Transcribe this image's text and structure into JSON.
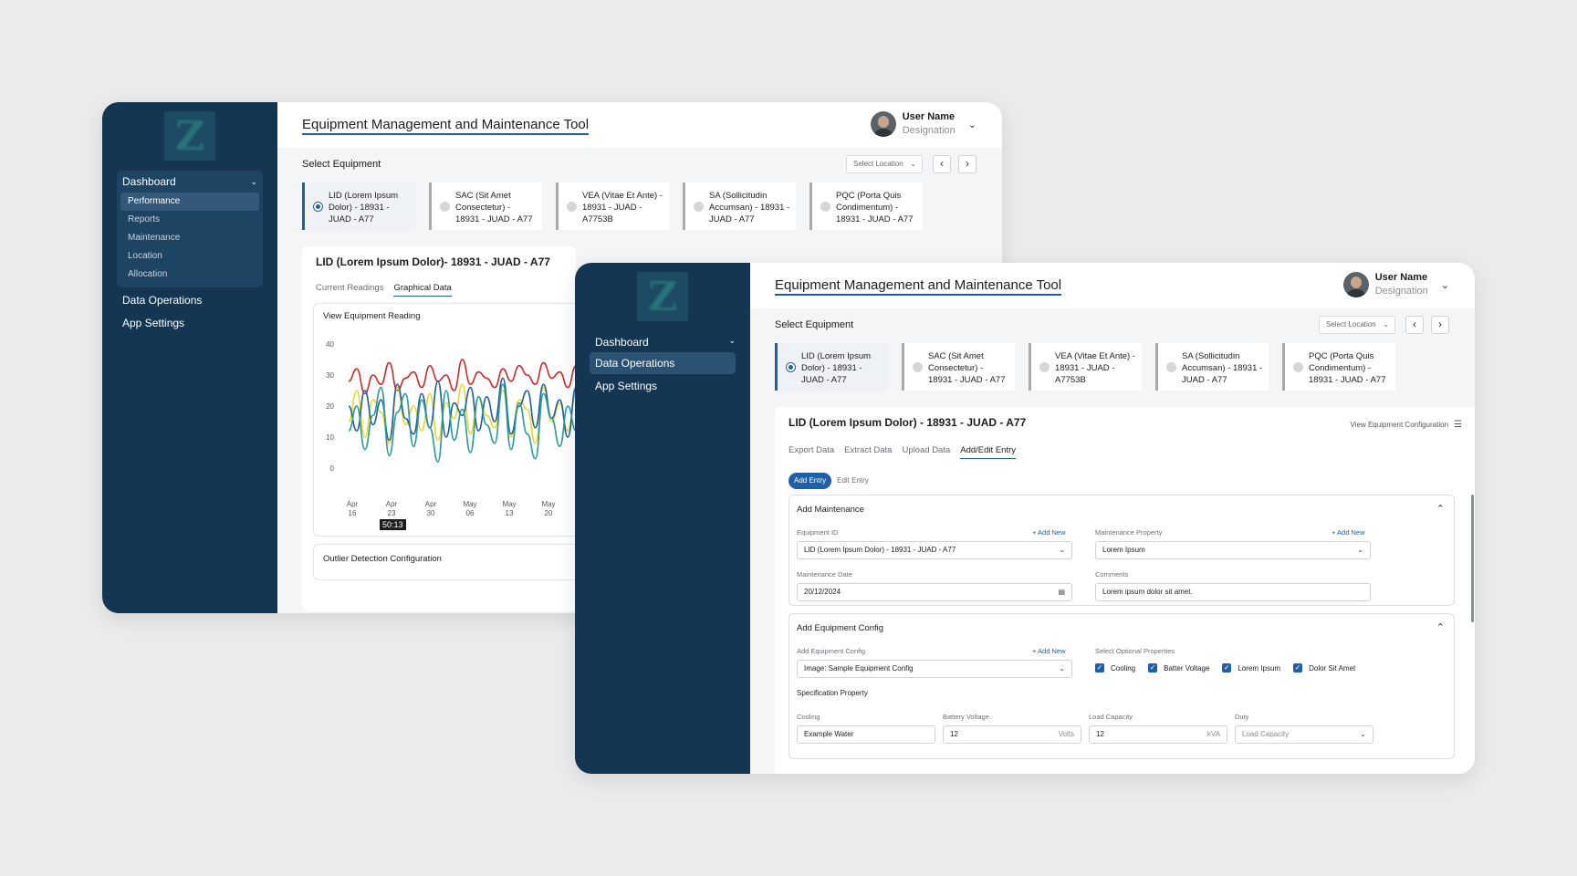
{
  "back": {
    "app_title": "Equipment Management and Maintenance Tool",
    "user": {
      "name": "User Name",
      "designation": "Designation"
    },
    "sidebar": {
      "group": {
        "label": "Dashboard",
        "items": [
          "Performance",
          "Reports",
          "Maintenance",
          "Location",
          "Allocation"
        ],
        "active": "Performance"
      },
      "items": [
        "Data Operations",
        "App Settings"
      ]
    },
    "select_equipment": "Select Equipment",
    "location_placeholder": "Select Location",
    "equipment": [
      "LID (Lorem Ipsum Dolor) - 18931 - JUAD - A77",
      "SAC (Sit Amet Consectetur) - 18931 - JUAD - A77",
      "VEA (Vitae Et Ante) - 18931 - JUAD - A7753B",
      "SA (Sollicitudin Accumsan) - 18931 - JUAD - A77",
      "PQC (Porta Quis Condimentum) - 18931 - JUAD - A77"
    ],
    "detail_title": "LID (Lorem Ipsum Dolor)- 18931 - JUAD - A77",
    "tabs": [
      "Current Readings",
      "Graphical Data"
    ],
    "chart_title": "View Equipment Reading",
    "tooltip": "50:13",
    "outlier_title": "Outlier Detection Configuration"
  },
  "chart_data": {
    "type": "line",
    "title": "View Equipment Reading",
    "x_ticks": [
      [
        "Apr",
        "16"
      ],
      [
        "Apr",
        "23"
      ],
      [
        "Apr",
        "30"
      ],
      [
        "May",
        "06"
      ],
      [
        "May",
        "13"
      ],
      [
        "May",
        "20"
      ]
    ],
    "y_ticks": [
      0,
      10,
      20,
      30,
      40
    ],
    "ylim": [
      0,
      40
    ],
    "colors": [
      "#d62a2a",
      "#e8d72e",
      "#1f5fa8",
      "#2a9a9a"
    ],
    "series": [
      {
        "values": [
          28,
          32,
          24,
          30,
          27,
          34,
          25,
          29,
          31,
          26,
          33,
          28,
          30,
          25,
          35,
          27,
          31,
          29,
          26,
          32,
          28,
          33,
          30,
          27,
          34,
          29,
          31,
          26,
          33,
          30
        ]
      },
      {
        "values": [
          15,
          25,
          10,
          22,
          18,
          8,
          26,
          14,
          20,
          12,
          24,
          9,
          21,
          16,
          27,
          11,
          23,
          17,
          13,
          25,
          10,
          22,
          19,
          8,
          26,
          15,
          21,
          12,
          24,
          18
        ]
      },
      {
        "values": [
          20,
          12,
          25,
          14,
          22,
          9,
          27,
          16,
          11,
          24,
          13,
          28,
          10,
          21,
          17,
          26,
          12,
          23,
          15,
          29,
          11,
          20,
          25,
          13,
          27,
          16,
          22,
          10,
          26,
          19
        ]
      },
      {
        "values": [
          12,
          20,
          6,
          17,
          26,
          4,
          18,
          24,
          7,
          22,
          13,
          2,
          25,
          9,
          19,
          5,
          23,
          14,
          8,
          27,
          6,
          21,
          11,
          3,
          24,
          16,
          7,
          20,
          12,
          25
        ]
      }
    ]
  },
  "front": {
    "app_title": "Equipment Management and Maintenance Tool",
    "user": {
      "name": "User Name",
      "designation": "Designation"
    },
    "sidebar": {
      "items": [
        "Dashboard",
        "Data Operations",
        "App Settings"
      ],
      "active": "Data Operations"
    },
    "select_equipment": "Select Equipment",
    "location_placeholder": "Select Location",
    "equipment": [
      "LID (Lorem Ipsum Dolor) - 18931 - JUAD - A77",
      "SAC (Sit Amet Consectetur) - 18931 - JUAD - A77",
      "VEA (Vitae Et Ante) - 18931 - JUAD - A7753B",
      "SA (Sollicitudin Accumsan) - 18931 - JUAD - A77",
      "PQC (Porta Quis Condimentum) - 18931 - JUAD - A77"
    ],
    "detail_title": "LID (Lorem Ipsum Dolor) - 18931 - JUAD - A77",
    "config_link": "View Equipment Configuration",
    "tabs": [
      "Export Data",
      "Extract Data",
      "Upload Data",
      "Add/Edit Entry"
    ],
    "toggle": [
      "Add Entry",
      "Edit Entry"
    ],
    "maintenance": {
      "title": "Add Maintenance",
      "equipment_id_label": "Equipment ID",
      "equipment_id_value": "LID (Lorem Ipsum Dolor) - 18931 - JUAD - A77",
      "property_label": "Maintenance Property",
      "property_value": "Lorem Ipsum",
      "date_label": "Maintenance Date",
      "date_value": "20/12/2024",
      "comments_label": "Comments",
      "comments_value": "Lorem ipsum dolor sit amet.",
      "add_new": "+ Add New"
    },
    "config": {
      "title": "Add Equipment Config",
      "config_label": "Add Equipment Config",
      "config_value": "Image: Sample Equipment Config",
      "optional_label": "Select Optional Properties",
      "optional": [
        "Cooling",
        "Batter Voltage",
        "Lorem Ipsum",
        "Dolor Sit Amet"
      ],
      "spec_label": "Specification Property",
      "cooling_label": "Cooling",
      "cooling_value": "Example Water",
      "battery_label": "Battery Voltage",
      "battery_value": "12",
      "battery_unit": "Volts",
      "load_label": "Load Capacity",
      "load_value": "12",
      "load_unit": "kVA",
      "duty_label": "Duty",
      "duty_placeholder": "Load Capacity",
      "add_new": "+ Add New"
    }
  }
}
